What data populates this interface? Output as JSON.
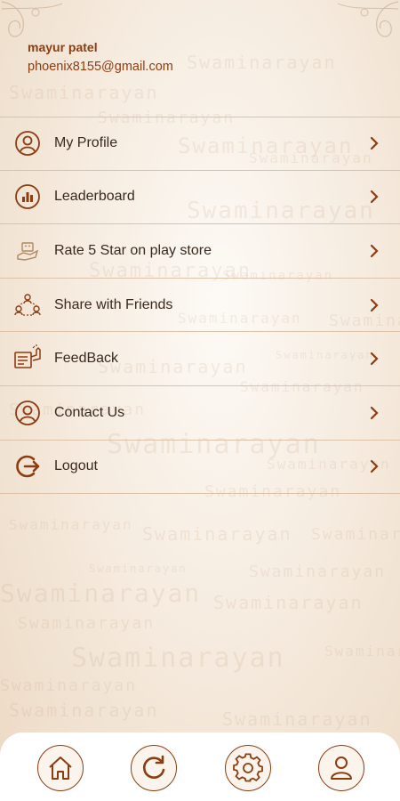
{
  "watermark_text": "Swaminarayan",
  "user": {
    "name": "mayur patel",
    "email": "phoenix8155@gmail.com"
  },
  "menu": [
    {
      "label": "My Profile",
      "icon": "user-circle-icon"
    },
    {
      "label": "Leaderboard",
      "icon": "bar-chart-icon"
    },
    {
      "label": "Rate 5 Star on play store",
      "icon": "rating-hand-icon"
    },
    {
      "label": "Share with Friends",
      "icon": "share-people-icon"
    },
    {
      "label": "FeedBack",
      "icon": "feedback-icon"
    },
    {
      "label": "Contact Us",
      "icon": "user-circle-icon"
    },
    {
      "label": "Logout",
      "icon": "logout-icon"
    }
  ],
  "bottom_nav": [
    {
      "icon": "home-icon"
    },
    {
      "icon": "refresh-icon"
    },
    {
      "icon": "settings-gear-icon"
    },
    {
      "icon": "profile-icon"
    }
  ],
  "colors": {
    "accent": "#8c3d10",
    "text": "#3a2a1e",
    "divider": "#dcc2a8",
    "background": "#f6ece0"
  }
}
